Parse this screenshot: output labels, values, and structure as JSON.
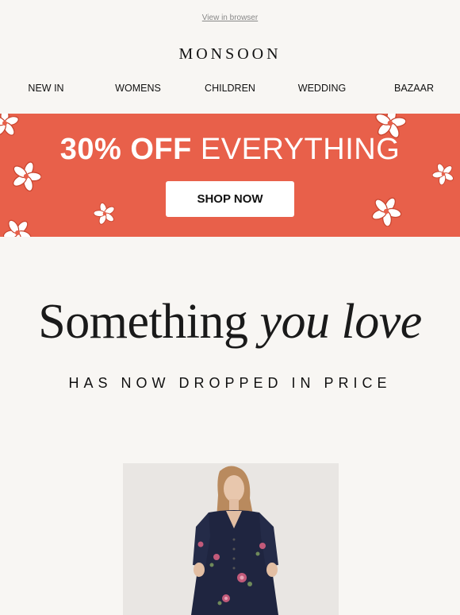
{
  "header": {
    "view_in_browser": "View in browser",
    "logo": "MONSOON"
  },
  "nav": {
    "items": [
      {
        "label": "NEW IN"
      },
      {
        "label": "WOMENS"
      },
      {
        "label": "CHILDREN"
      },
      {
        "label": "WEDDING"
      },
      {
        "label": "BAZAAR"
      }
    ]
  },
  "banner": {
    "headline_bold": "30% OFF",
    "headline_regular": "EVERYTHING",
    "button_label": "SHOP NOW",
    "background_color": "#e8604a"
  },
  "hero": {
    "headline_regular": "Something",
    "headline_italic": "you love",
    "subline": "HAS NOW DROPPED IN PRICE"
  },
  "product": {
    "image_icon": "navy-floral-dress-photo"
  }
}
